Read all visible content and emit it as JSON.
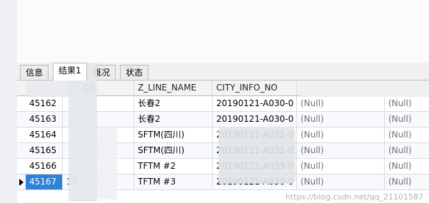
{
  "tabs": [
    {
      "label": "信息",
      "active": false
    },
    {
      "label": "结果1",
      "active": true
    },
    {
      "label": "概况",
      "active": false
    },
    {
      "label": "状态",
      "active": false
    }
  ],
  "grid": {
    "columns": [
      "",
      "_CODE",
      "Z_LINE_NAME",
      "CITY_INFO_NO",
      "",
      ""
    ],
    "rows": [
      {
        "id": "45162",
        "code": "",
        "line": "长春2",
        "city": "20190121-A030-0",
        "c5": "(Null)",
        "c6": "(Null)"
      },
      {
        "id": "45163",
        "code": "",
        "line": "长春2",
        "city": "20190121-A030-0",
        "c5": "(Null)",
        "c6": "(Null)"
      },
      {
        "id": "45164",
        "code": "",
        "line": "SFTM(四川)",
        "city": "20190121-A032-0",
        "c5": "(Null)",
        "c6": "(Null)"
      },
      {
        "id": "45165",
        "code": "",
        "line": "SFTM(四川)",
        "city": "20190121-A032-0",
        "c5": "(Null)",
        "c6": "(Null)"
      },
      {
        "id": "45166",
        "code": "",
        "line": "TFTM #2",
        "city": "20190121-A033-0",
        "c5": "(Null)",
        "c6": "(Null)"
      },
      {
        "id": "45167",
        "code": "13",
        "line": "TFTM #3",
        "city": "20190121-A030-0",
        "c5": "(Null)",
        "c6": "(Null)"
      }
    ]
  },
  "watermark": "https://blog.csdn.net/qq_21101587",
  "colors": {
    "selection": "#2f82d8",
    "null_text": "#6f6f6f"
  }
}
